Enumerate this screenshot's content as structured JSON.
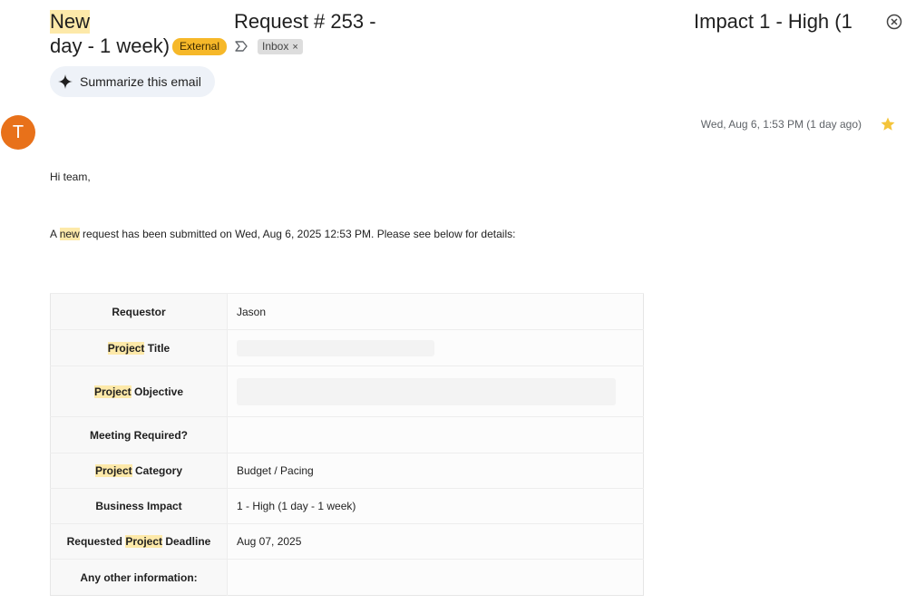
{
  "header": {
    "subject_part1": "New",
    "subject_part2": "Request # 253 -",
    "subject_part3": "Impact 1 - High (1",
    "subject_line2": "day - 1 week)",
    "external_badge": "External",
    "inbox_chip": "Inbox",
    "summarize_label": "Summarize this email"
  },
  "message": {
    "avatar_letter": "T",
    "date": "Wed, Aug 6, 1:53 PM (1 day ago)",
    "greeting": "Hi team,",
    "intro_before": "A ",
    "intro_highlight": "new",
    "intro_after": " request has been submitted on Wed, Aug 6, 2025 12:53 PM. Please see below for details:"
  },
  "details": {
    "rows": [
      {
        "label_pre": "",
        "label_hl": "",
        "label_post": "Requestor",
        "value": "Jason"
      },
      {
        "label_pre": "",
        "label_hl": "Project",
        "label_post": " Title",
        "value": ""
      },
      {
        "label_pre": "",
        "label_hl": "Project",
        "label_post": " Objective",
        "value": ""
      },
      {
        "label_pre": "",
        "label_hl": "",
        "label_post": "Meeting Required?",
        "value": ""
      },
      {
        "label_pre": "",
        "label_hl": "Project",
        "label_post": " Category",
        "value": "Budget / Pacing"
      },
      {
        "label_pre": "",
        "label_hl": "",
        "label_post": "Business Impact",
        "value": "1 - High (1 day - 1 week)"
      },
      {
        "label_pre": "Requested ",
        "label_hl": "Project",
        "label_post": " Deadline",
        "value": "Aug 07, 2025"
      },
      {
        "label_pre": "",
        "label_hl": "",
        "label_post": "Any other information:",
        "value": ""
      }
    ]
  },
  "colors": {
    "highlight": "#fde9a9",
    "external_badge": "#f6b829",
    "avatar": "#e8711a",
    "star": "#f4c43a"
  }
}
